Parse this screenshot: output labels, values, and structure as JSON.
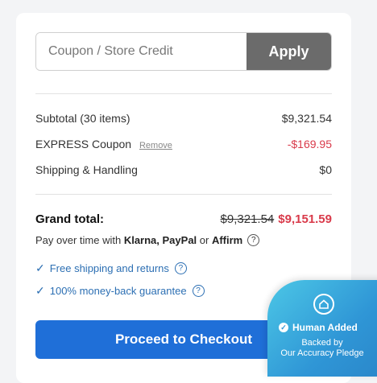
{
  "coupon": {
    "placeholder": "Coupon / Store Credit",
    "apply_label": "Apply"
  },
  "summary": {
    "subtotal_label": "Subtotal (30 items)",
    "subtotal_value": "$9,321.54",
    "coupon_label": "EXPRESS Coupon",
    "remove_label": "Remove",
    "coupon_value": "-$169.95",
    "shipping_label": "Shipping & Handling",
    "shipping_value": "$0"
  },
  "grand_total": {
    "label": "Grand total:",
    "old_price": "$9,321.54",
    "new_price": "$9,151.59"
  },
  "pay_later": {
    "prefix": "Pay over time with",
    "providers": "Klarna, PayPal",
    "or": "or",
    "last_provider": "Affirm"
  },
  "benefits": [
    {
      "label": "Free shipping and returns"
    },
    {
      "label": "100% money-back guarantee"
    }
  ],
  "checkout": {
    "label": "Proceed to Checkout"
  },
  "badge": {
    "title": "Human Added",
    "line1": "Backed by",
    "line2": "Our Accuracy Pledge"
  },
  "colors": {
    "accent_blue": "#1f6fd8",
    "discount_red": "#d93a4a",
    "apply_gray": "#6b6b6b",
    "badge_cyan": "#4cc7e6"
  }
}
